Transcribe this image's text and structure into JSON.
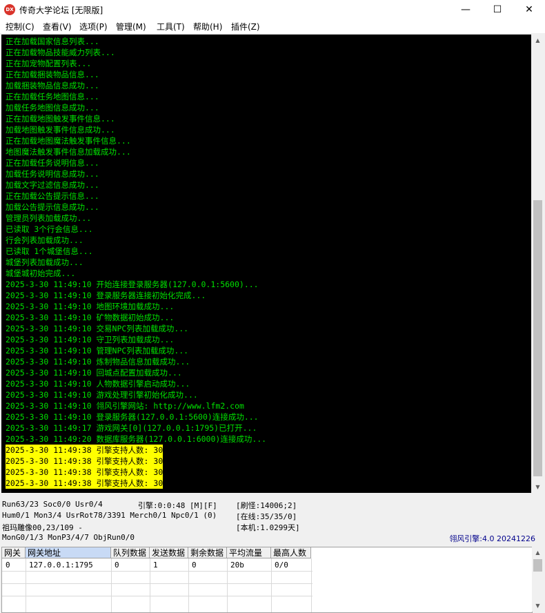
{
  "window": {
    "title": "传奇大学论坛 [无限版]",
    "app_icon_text": "DX"
  },
  "menu": [
    {
      "label": "控制(C)"
    },
    {
      "label": "查看(V)"
    },
    {
      "label": "选项(P)"
    },
    {
      "label": "管理(M)"
    },
    {
      "label": "工具(T)"
    },
    {
      "label": "帮助(H)"
    },
    {
      "label": "插件(Z)"
    }
  ],
  "console": {
    "lines": [
      "正在加载国家信息列表...",
      "正在加载物品技能威力列表...",
      "正在加宠物配置列表...",
      "正在加载捆装物品信息...",
      "加载捆装物品信息成功...",
      "正在加载任务地图信息...",
      "加载任务地图信息成功...",
      "正在加载地图触发事件信息...",
      "加载地图触发事件信息成功...",
      "正在加载地图魔法触发事件信息...",
      "地图魔法触发事件信息加载成功...",
      "正在加载任务说明信息...",
      "加载任务说明信息成功...",
      "加载文字过滤信息成功...",
      "正在加载公告提示信息...",
      "加载公告提示信息成功...",
      "管理员列表加载成功...",
      "已读取 3个行会信息...",
      "行会列表加载成功...",
      "已读取 1个城堡信息...",
      "城堡列表加载成功...",
      "城堡城初始完成...",
      "2025-3-30 11:49:10 开始连接登录服务器(127.0.0.1:5600)...",
      "2025-3-30 11:49:10 登录服务器连接初始化完成...",
      "2025-3-30 11:49:10 地图环境加载成功...",
      "2025-3-30 11:49:10 矿物数据初始成功...",
      "2025-3-30 11:49:10 交易NPC列表加载成功...",
      "2025-3-30 11:49:10 守卫列表加载成功...",
      "2025-3-30 11:49:10 管理NPC列表加载成功...",
      "2025-3-30 11:49:10 炼制物品信息加载成功...",
      "2025-3-30 11:49:10 回城点配置加载成功...",
      "2025-3-30 11:49:10 人物数据引擎启动成功...",
      "2025-3-30 11:49:10 游戏处理引擎初始化成功...",
      "2025-3-30 11:49:10 翎风引擎网站: http://www.lfm2.com",
      "2025-3-30 11:49:10 登录服务器(127.0.0.1:5600)连接成功...",
      "2025-3-30 11:49:17 游戏网关[0](127.0.0.1:1795)已打开...",
      "2025-3-30 11:49:20 数据库服务器(127.0.0.1:6000)连接成功..."
    ],
    "highlighted_lines": [
      "2025-3-30 11:49:38 引擎支持人数: 30",
      "2025-3-30 11:49:38 引擎支持人数: 30",
      "2025-3-30 11:49:38 引擎支持人数: 30",
      "2025-3-30 11:49:38 引擎支持人数: 30"
    ],
    "text_color": "#00e000",
    "highlight_color": "#ffff00"
  },
  "status": {
    "run": "Run63/23 Soc0/0 Usr0/4",
    "engine": "引擎:0:0:48 [M][F]",
    "refresh_monsters": "[刷怪:14006;2]",
    "hum": "Hum0/1 Mon3/4 UsrRot78/3391 Merch0/1 Npc0/1 (0)",
    "online": "[在线:35/35/0]",
    "mapinfo": "祖玛雕像00,23/109 -",
    "local": "[本机:1.0299天]",
    "mon": "MonG0/1/3 MonP3/4/7 ObjRun0/0",
    "engine_version": "翎风引擎:4.0 20241226"
  },
  "gate_table": {
    "headers": [
      "网关",
      "网关地址",
      "队列数据",
      "发送数据",
      "剩余数据",
      "平均流量",
      "最高人数"
    ],
    "rows": [
      [
        "0",
        "127.0.0.1:1795",
        "0",
        "1",
        "0",
        "20b",
        "0/0"
      ]
    ]
  }
}
